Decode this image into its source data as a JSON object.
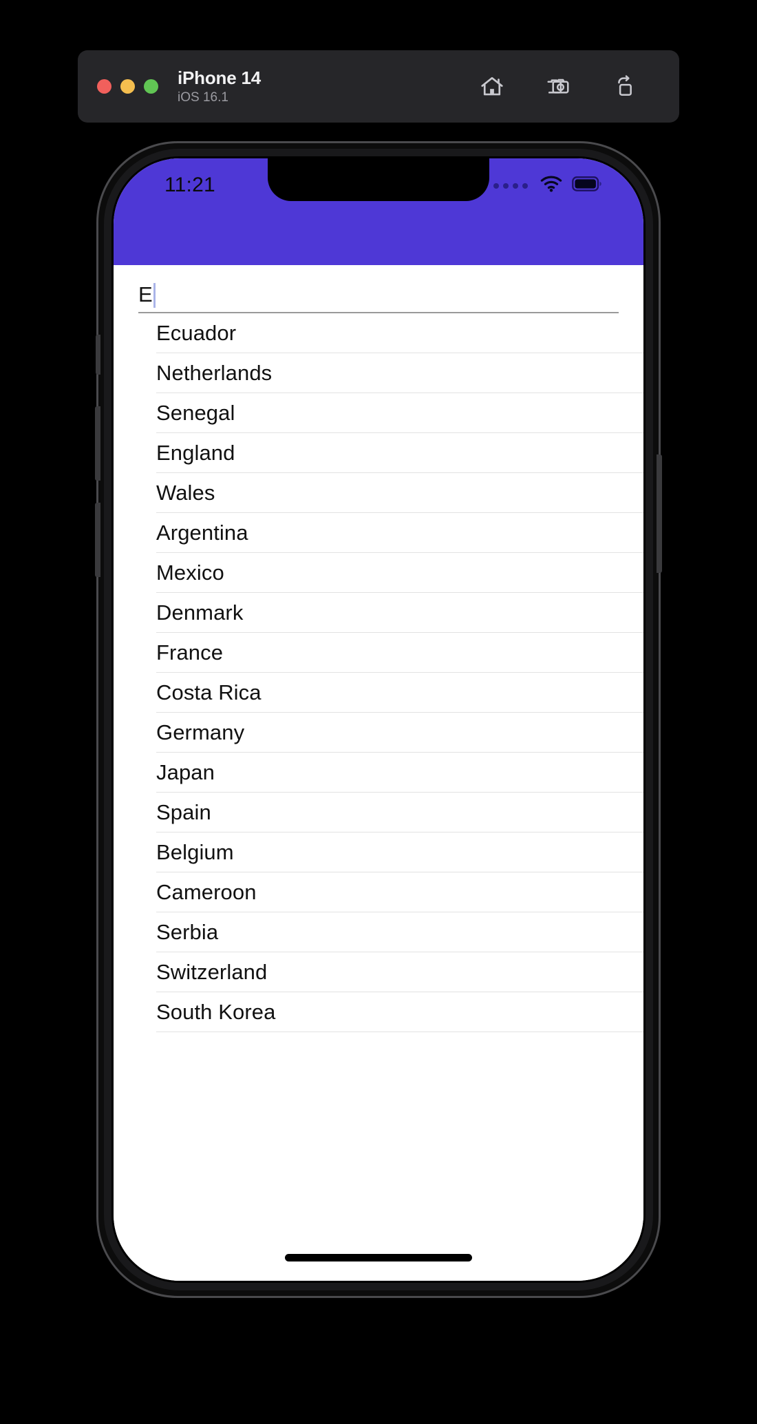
{
  "simulator": {
    "window_controls": [
      {
        "name": "close",
        "color": "#F1605C"
      },
      {
        "name": "minimize",
        "color": "#F4BE4F"
      },
      {
        "name": "zoom",
        "color": "#61C554"
      }
    ],
    "device_name": "iPhone 14",
    "os_version": "iOS 16.1",
    "actions": [
      {
        "name": "home-icon",
        "label": "Home"
      },
      {
        "name": "screenshot-icon",
        "label": "Screenshot"
      },
      {
        "name": "rotate-icon",
        "label": "Rotate"
      }
    ]
  },
  "status_bar": {
    "time": "11:21",
    "background_color": "#4E38D6",
    "signal_icon": "cellular-signal-icon",
    "wifi_icon": "wifi-icon",
    "battery_icon": "battery-icon"
  },
  "app": {
    "search": {
      "value": "E",
      "placeholder": ""
    },
    "results": [
      "Ecuador",
      "Netherlands",
      "Senegal",
      "England",
      "Wales",
      "Argentina",
      "Mexico",
      "Denmark",
      "France",
      "Costa Rica",
      "Germany",
      "Japan",
      "Spain",
      "Belgium",
      "Cameroon",
      "Serbia",
      "Switzerland",
      "South Korea"
    ]
  }
}
